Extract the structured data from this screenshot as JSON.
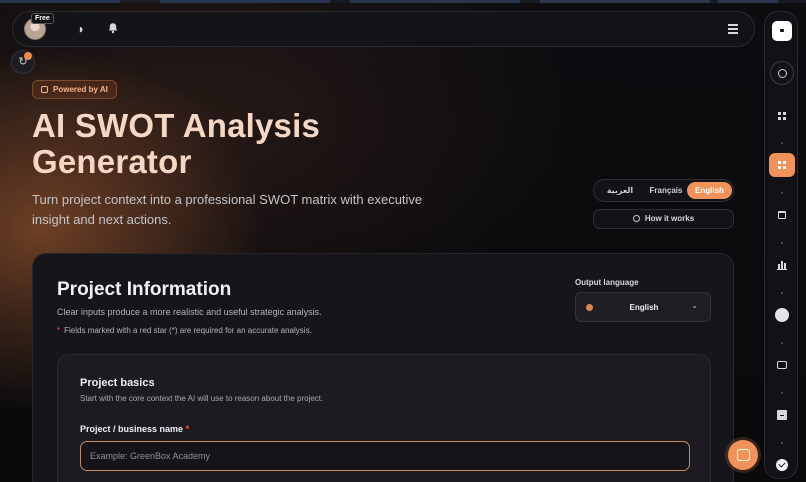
{
  "topbar": {
    "plan_badge": "Free",
    "icons": [
      "avatar",
      "theme-contrast-icon",
      "bell-icon",
      "menu-icon"
    ]
  },
  "hero": {
    "badge": "Powered by AI",
    "title_line1": "AI SWOT Analysis",
    "title_line2": "Generator",
    "subtitle": "Turn project context into a professional SWOT matrix with executive insight and next actions."
  },
  "language_switch": {
    "options": [
      "العربية",
      "Français",
      "English"
    ],
    "selected": "English"
  },
  "how_it_works": "How it works",
  "project_info": {
    "title": "Project Information",
    "subtitle": "Clear inputs produce a more realistic and useful strategic analysis.",
    "required_note": "Fields marked with a red star (*) are required for an accurate analysis.",
    "required_star": "*",
    "output_language_label": "Output language",
    "output_language_value": "English"
  },
  "project_basics": {
    "title": "Project basics",
    "subtitle": "Start with the core context the AI will use to reason about the project.",
    "name_label": "Project / business name",
    "name_star": "*",
    "name_placeholder": "Example: GreenBox Academy",
    "name_value": ""
  },
  "rail": {
    "items": [
      "logo",
      "search-icon",
      "dashboard-icon",
      "grid-icon",
      "calendar-icon",
      "bar-chart-icon",
      "settings-icon",
      "message-icon",
      "archive-icon",
      "check-icon"
    ],
    "active": "grid-icon"
  },
  "colors": {
    "accent": "#f0925a",
    "title": "#f4d7c4",
    "background": "#0b0b0e",
    "card": "#15151a",
    "required": "#ff4d4d"
  }
}
